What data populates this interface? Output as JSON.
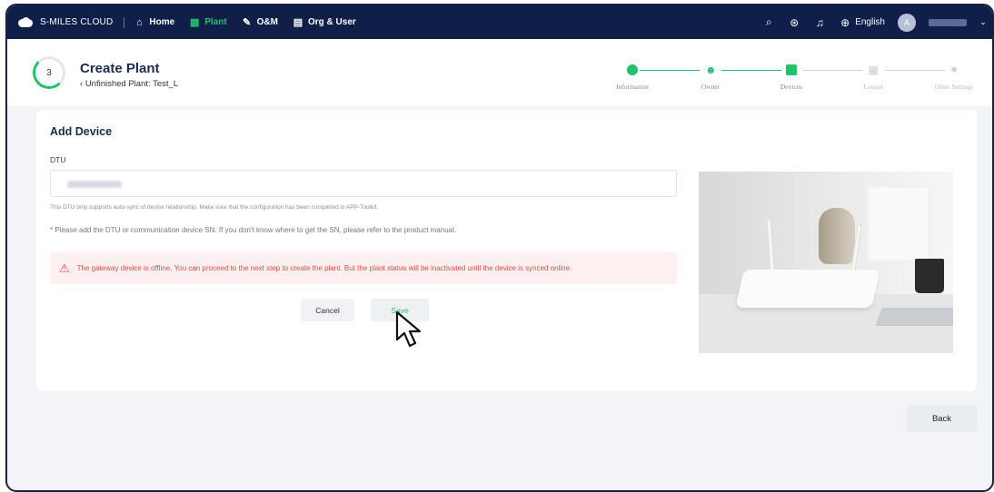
{
  "topbar": {
    "brand": "S-MILES CLOUD",
    "nav": [
      {
        "label": "Home",
        "icon": "home-icon",
        "active": false
      },
      {
        "label": "Plant",
        "icon": "plant-icon",
        "active": true
      },
      {
        "label": "O&M",
        "icon": "wrench-icon",
        "active": false
      },
      {
        "label": "Org & User",
        "icon": "document-icon",
        "active": false
      }
    ],
    "language": "English",
    "avatar_initial": "A"
  },
  "header": {
    "step_number": "3",
    "title": "Create Plant",
    "subtitle": "Unfinished Plant: Test_L",
    "steps": [
      {
        "label": "Information",
        "icon": "info-icon",
        "state": "done"
      },
      {
        "label": "Owner",
        "icon": "user-icon",
        "state": "done"
      },
      {
        "label": "Devices",
        "icon": "device-icon",
        "state": "current"
      },
      {
        "label": "Layout",
        "icon": "grid-icon",
        "state": "pending"
      },
      {
        "label": "Other Settings",
        "icon": "gear-icon",
        "state": "pending"
      }
    ]
  },
  "form": {
    "title": "Add Device",
    "field_label": "DTU",
    "hint_sync": "This DTU only supports auto-sync of device relationship. Make sure that the configuration has been completed in APP-Toolkit.",
    "hint_sn": "* Please add the DTU or communication device SN. If you don't know where to get the SN, please refer to the product manual.",
    "alert": "The gateway device is offline. You can proceed to the next step to create the plant. But the plant status will be inactivated until the device is synced online.",
    "cancel_label": "Cancel",
    "save_label": "Save"
  },
  "footer": {
    "back_label": "Back"
  },
  "colors": {
    "topbar": "#0f1f4a",
    "accent": "#24c16b",
    "alert_text": "#e24b4b",
    "alert_bg": "#fdf0f0"
  }
}
